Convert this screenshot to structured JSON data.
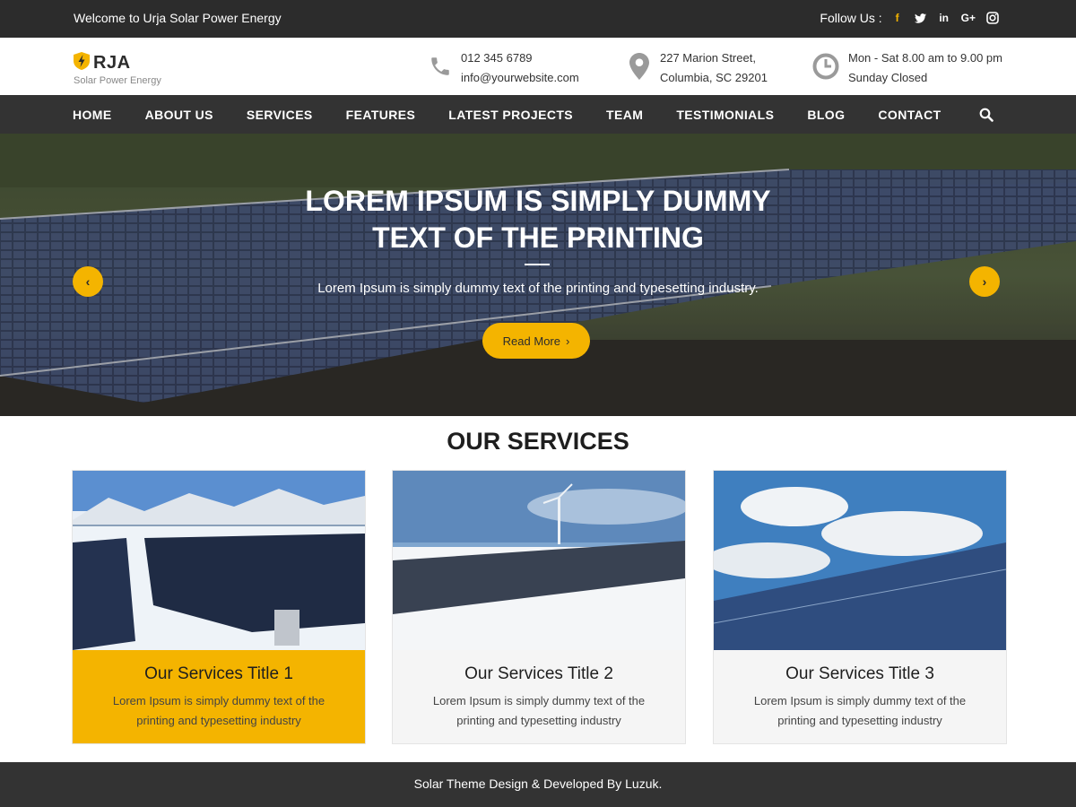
{
  "topbar": {
    "welcome": "Welcome to Urja Solar Power Energy",
    "follow_label": "Follow Us :",
    "social": [
      {
        "icon": "facebook-icon",
        "glyph": "f"
      },
      {
        "icon": "twitter-icon",
        "glyph": "t"
      },
      {
        "icon": "linkedin-icon",
        "glyph": "in"
      },
      {
        "icon": "google-plus-icon",
        "glyph": "G+"
      },
      {
        "icon": "instagram-icon",
        "glyph": ""
      }
    ]
  },
  "header": {
    "logo_text": "RJA",
    "tagline": "Solar Power Energy",
    "phone": "012 345 6789",
    "email": "info@yourwebsite.com",
    "address_line1": "227 Marion Street,",
    "address_line2": "Columbia, SC 29201",
    "hours_line1": "Mon - Sat 8.00 am to 9.00 pm",
    "hours_line2": "Sunday Closed"
  },
  "nav": {
    "items": [
      "HOME",
      "ABOUT US",
      "SERVICES",
      "FEATURES",
      "LATEST PROJECTS",
      "TEAM",
      "TESTIMONIALS",
      "BLOG",
      "CONTACT"
    ]
  },
  "hero": {
    "title": "LOREM IPSUM IS SIMPLY DUMMY TEXT OF THE PRINTING",
    "subtitle": "Lorem Ipsum is simply dummy text of the printing and typesetting industry.",
    "button_label": "Read More",
    "button_arrow": "›",
    "prev_arrow": "‹",
    "next_arrow": "›"
  },
  "services": {
    "heading": "OUR SERVICES",
    "cards": [
      {
        "title": "Our Services Title 1",
        "text": "Lorem Ipsum is simply dummy text of the printing and typesetting industry"
      },
      {
        "title": "Our Services Title 2",
        "text": "Lorem Ipsum is simply dummy text of the printing and typesetting industry"
      },
      {
        "title": "Our Services Title 3",
        "text": "Lorem Ipsum is simply dummy text of the printing and typesetting industry"
      }
    ]
  },
  "footer": {
    "text": "Solar Theme Design & Developed By Luzuk."
  },
  "colors": {
    "accent": "#f4b400",
    "dark": "#2c2c2c",
    "nav": "#333333"
  }
}
